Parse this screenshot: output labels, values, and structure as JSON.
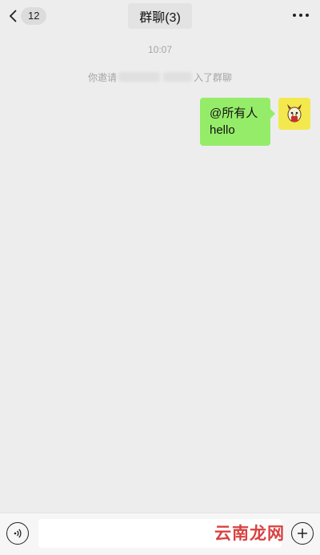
{
  "header": {
    "unread_count": "12",
    "title": "群聊(3)"
  },
  "chat": {
    "timestamp": "10:07",
    "system_message": {
      "prefix": "你邀请",
      "suffix": "入了群聊"
    },
    "messages": [
      {
        "sender": "me",
        "lines": [
          "@所有人",
          "hello"
        ]
      }
    ]
  },
  "input": {
    "value": "",
    "placeholder": ""
  },
  "watermark": "云南龙网",
  "colors": {
    "background": "#ededed",
    "bubble_green": "#95ec69",
    "avatar_yellow": "#f3e84d",
    "watermark_red": "#d32020"
  },
  "icons": {
    "back": "chevron-left-icon",
    "more": "more-dots-icon",
    "voice": "voice-icon",
    "plus": "plus-icon"
  }
}
